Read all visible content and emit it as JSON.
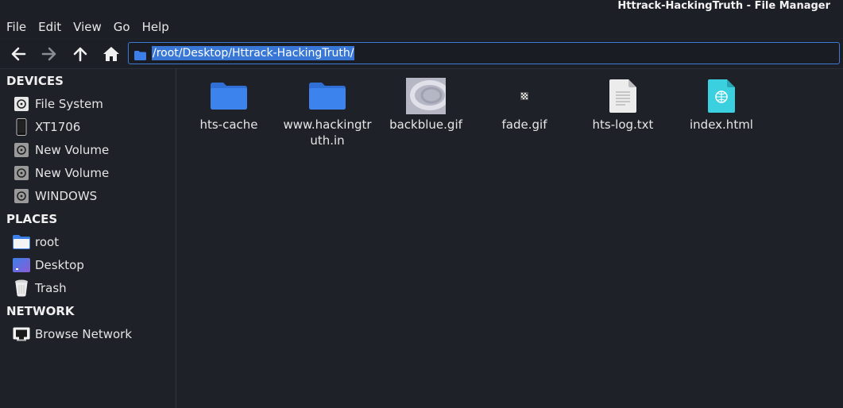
{
  "window": {
    "title": "Httrack-HackingTruth - File Manager"
  },
  "menu": [
    {
      "label": "File"
    },
    {
      "label": "Edit"
    },
    {
      "label": "View"
    },
    {
      "label": "Go"
    },
    {
      "label": "Help"
    }
  ],
  "toolbar": {
    "back_icon": "arrow-left-icon",
    "forward_icon": "arrow-right-icon",
    "up_icon": "arrow-up-icon",
    "home_icon": "home-icon"
  },
  "location": {
    "path": "/root/Desktop/Httrack-HackingTruth/"
  },
  "sidebar": {
    "devices": {
      "heading": "DEVICES",
      "items": [
        {
          "label": "File System",
          "icon": "drive-icon"
        },
        {
          "label": "XT1706",
          "icon": "phone-icon"
        },
        {
          "label": "New Volume",
          "icon": "drive-icon"
        },
        {
          "label": "New Volume",
          "icon": "drive-icon"
        },
        {
          "label": "WINDOWS",
          "icon": "drive-icon"
        }
      ]
    },
    "places": {
      "heading": "PLACES",
      "items": [
        {
          "label": "root",
          "icon": "home-folder-icon"
        },
        {
          "label": "Desktop",
          "icon": "desktop-icon"
        },
        {
          "label": "Trash",
          "icon": "trash-icon"
        }
      ]
    },
    "network": {
      "heading": "NETWORK",
      "items": [
        {
          "label": "Browse Network",
          "icon": "network-icon"
        }
      ]
    }
  },
  "files": [
    {
      "name": "hts-cache",
      "icon": "folder-icon"
    },
    {
      "name": "www.hackingtruth.in",
      "icon": "folder-icon"
    },
    {
      "name": "backblue.gif",
      "icon": "image-thumbnail-icon"
    },
    {
      "name": "fade.gif",
      "icon": "image-thumbnail-icon"
    },
    {
      "name": "hts-log.txt",
      "icon": "text-file-icon"
    },
    {
      "name": "index.html",
      "icon": "html-file-icon"
    }
  ],
  "colors": {
    "background": "#1f2129",
    "accent": "#3877d6",
    "folder": "#3d7fe8",
    "html_icon": "#3ad0e0"
  }
}
